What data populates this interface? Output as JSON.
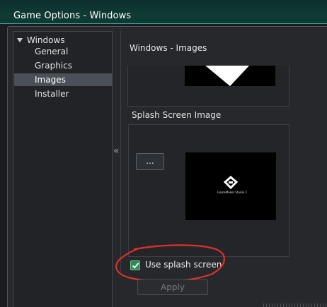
{
  "window": {
    "title": "Game Options - Windows"
  },
  "sidebar": {
    "root_label": "Windows",
    "items": [
      {
        "label": "General",
        "selected": false
      },
      {
        "label": "Graphics",
        "selected": false
      },
      {
        "label": "Images",
        "selected": true
      },
      {
        "label": "Installer",
        "selected": false
      }
    ],
    "collapse_glyph": "«"
  },
  "main": {
    "header": "Windows - Images",
    "splash": {
      "label": "Splash Screen Image",
      "browse_label": "...",
      "preview_text": "GameMaker Studio 2"
    },
    "use_splash": {
      "label": "Use splash screen",
      "checked": true
    },
    "apply_label": "Apply"
  },
  "colors": {
    "titlebar": "#0f3a33",
    "accent": "#3ea895",
    "checkbox": "#2f8a56",
    "annotation": "#e0312b"
  }
}
